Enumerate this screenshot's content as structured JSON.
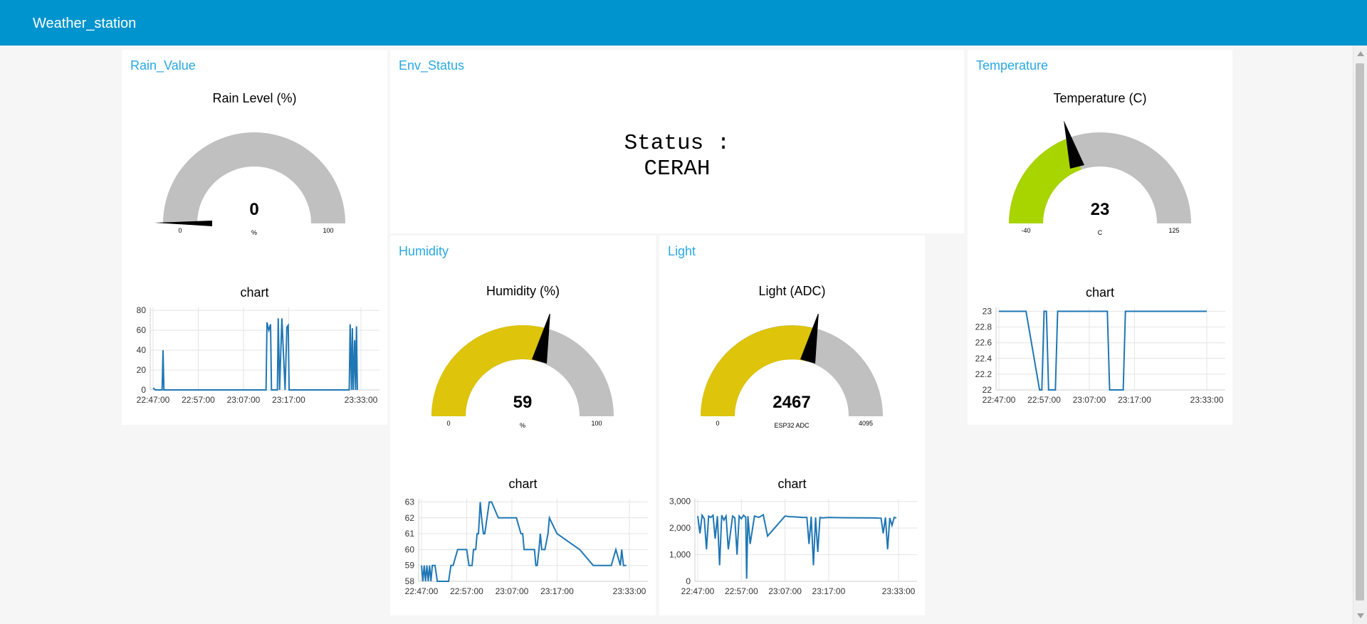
{
  "header": {
    "title": "Weather_station"
  },
  "colors": {
    "header": "#0094ce",
    "card_title": "#29a8e0",
    "gauge_track": "#c0c0c0",
    "humidity_fill": "#dec40a",
    "light_fill": "#dec40a",
    "temperature_fill": "#a8d400",
    "chart_line": "#1f77b4"
  },
  "cards": {
    "rain": {
      "title": "Rain_Value",
      "gauge_label": "Rain Level (%)",
      "value": "0",
      "unit": "%",
      "min": "0",
      "max": "100",
      "chart_label": "chart"
    },
    "env": {
      "title": "Env_Status",
      "status_line1": "Status :",
      "status_line2": "CERAH"
    },
    "temperature": {
      "title": "Temperature",
      "gauge_label": "Temperature (C)",
      "value": "23",
      "unit": "C",
      "min": "-40",
      "max": "125",
      "chart_label": "chart"
    },
    "humidity": {
      "title": "Humidity",
      "gauge_label": "Humidity (%)",
      "value": "59",
      "unit": "%",
      "min": "0",
      "max": "100",
      "chart_label": "chart"
    },
    "light": {
      "title": "Light",
      "gauge_label": "Light (ADC)",
      "value": "2467",
      "unit": "ESP32 ADC",
      "min": "0",
      "max": "4095",
      "chart_label": "chart"
    }
  },
  "chart_data": [
    {
      "id": "rain",
      "type": "line",
      "x_ticks": [
        "22:47:00",
        "22:57:00",
        "23:07:00",
        "23:17:00",
        "23:33:00"
      ],
      "y_ticks": [
        "0",
        "20",
        "40",
        "60",
        "80"
      ],
      "ylim": [
        0,
        83
      ],
      "series": [
        {
          "t": [
            0,
            0.5,
            1,
            2,
            2.2,
            2.4,
            3,
            5,
            10,
            20,
            25,
            25.2,
            25.4,
            25.6,
            26,
            26.2,
            26.5,
            27.5,
            27.7,
            28,
            28.5,
            29.2,
            29.6,
            29.9,
            30.1,
            30.5,
            30.8,
            35,
            40,
            42,
            43.4,
            43.6,
            43.9,
            44.1,
            44.3,
            44.6,
            44.8,
            45,
            45.2
          ],
          "v": [
            2,
            0,
            0,
            0,
            40,
            0,
            0,
            0,
            0,
            0,
            0,
            68,
            64,
            60,
            66,
            0,
            0,
            0,
            72,
            0,
            72,
            0,
            63,
            65,
            0,
            0,
            0,
            0,
            0,
            0,
            0,
            66,
            0,
            62,
            0,
            50,
            0,
            64,
            0
          ]
        }
      ]
    },
    {
      "id": "temperature",
      "type": "line",
      "x_ticks": [
        "22:47:00",
        "22:57:00",
        "23:07:00",
        "23:17:00",
        "23:33:00"
      ],
      "y_ticks": [
        "22",
        "22.2",
        "22.4",
        "22.6",
        "22.8",
        "23"
      ],
      "ylim": [
        22,
        23.05
      ],
      "series": [
        {
          "t": [
            0,
            6,
            9,
            9.5,
            10,
            10.5,
            11,
            12.5,
            13,
            20,
            24,
            24.5,
            25,
            27,
            27.5,
            28,
            28.5,
            46
          ],
          "v": [
            23,
            23,
            22,
            22,
            23,
            23,
            22,
            22,
            23,
            23,
            23,
            22,
            22,
            22,
            22,
            23,
            23,
            23
          ]
        }
      ]
    },
    {
      "id": "humidity",
      "type": "line",
      "x_ticks": [
        "22:47:00",
        "22:57:00",
        "23:07:00",
        "23:17:00",
        "23:33:00"
      ],
      "y_ticks": [
        "58",
        "59",
        "60",
        "61",
        "62",
        "63"
      ],
      "ylim": [
        58,
        63.2
      ],
      "series": [
        {
          "t": [
            0,
            0.3,
            0.6,
            0.9,
            1.2,
            1.5,
            1.8,
            2.1,
            2.4,
            3,
            3.5,
            4,
            6,
            6.5,
            7,
            8,
            10,
            10.5,
            10.8,
            11.2,
            11.5,
            12,
            12.3,
            12.6,
            13,
            13.3,
            13.7,
            14,
            15,
            15.5,
            17,
            17.5,
            18,
            21,
            22,
            22.4,
            22.7,
            23,
            23.3,
            24,
            25,
            25.3,
            25.6,
            26,
            26.3,
            26.6,
            27,
            27.3,
            28,
            28.3,
            30,
            35,
            38,
            40,
            42,
            43,
            44,
            44.3,
            44.7,
            45,
            45.3
          ],
          "v": [
            59,
            58,
            59,
            58,
            59,
            58,
            59,
            58,
            59,
            59,
            58,
            58,
            58,
            59,
            59,
            60,
            60,
            59,
            59,
            59,
            60,
            60,
            61,
            61,
            63,
            62,
            61,
            61,
            63,
            63,
            62,
            62,
            62,
            62,
            61,
            61,
            60,
            60,
            60,
            60,
            60,
            59,
            59,
            60,
            61,
            60,
            60,
            60,
            61,
            62,
            61,
            60,
            59,
            59,
            59,
            60,
            59,
            60,
            59,
            59,
            59
          ]
        }
      ]
    },
    {
      "id": "light",
      "type": "line",
      "x_ticks": [
        "22:47:00",
        "22:57:00",
        "23:07:00",
        "23:17:00",
        "23:33:00"
      ],
      "y_ticks": [
        "0",
        "1,000",
        "2,000",
        "3,000"
      ],
      "ylim": [
        0,
        3100
      ],
      "series": [
        {
          "t": [
            0,
            0.5,
            1,
            1.5,
            2,
            2.5,
            3,
            3.5,
            4,
            4.5,
            5,
            5.5,
            6,
            6.5,
            7,
            8,
            8.5,
            9,
            9.5,
            10,
            10.5,
            11,
            11.2,
            11.5,
            12,
            13,
            14,
            15,
            16,
            20,
            21,
            22,
            23,
            24,
            25,
            25.5,
            26,
            26.5,
            27,
            27.5,
            28,
            28.5,
            30,
            33,
            40,
            42,
            42.5,
            43,
            43.5,
            44,
            44.5,
            45,
            45.5
          ],
          "v": [
            2450,
            1800,
            2480,
            2350,
            1200,
            2450,
            2400,
            2480,
            1600,
            2450,
            600,
            2480,
            2300,
            2450,
            1200,
            2450,
            2380,
            1000,
            2450,
            2350,
            2480,
            2400,
            100,
            2450,
            1400,
            2450,
            2400,
            2500,
            1700,
            2450,
            2430,
            2420,
            2410,
            2400,
            2400,
            1400,
            2430,
            600,
            2400,
            1100,
            2400,
            2380,
            2400,
            2390,
            2380,
            2370,
            1800,
            2400,
            1200,
            2380,
            2100,
            2400,
            2380
          ]
        }
      ]
    }
  ]
}
